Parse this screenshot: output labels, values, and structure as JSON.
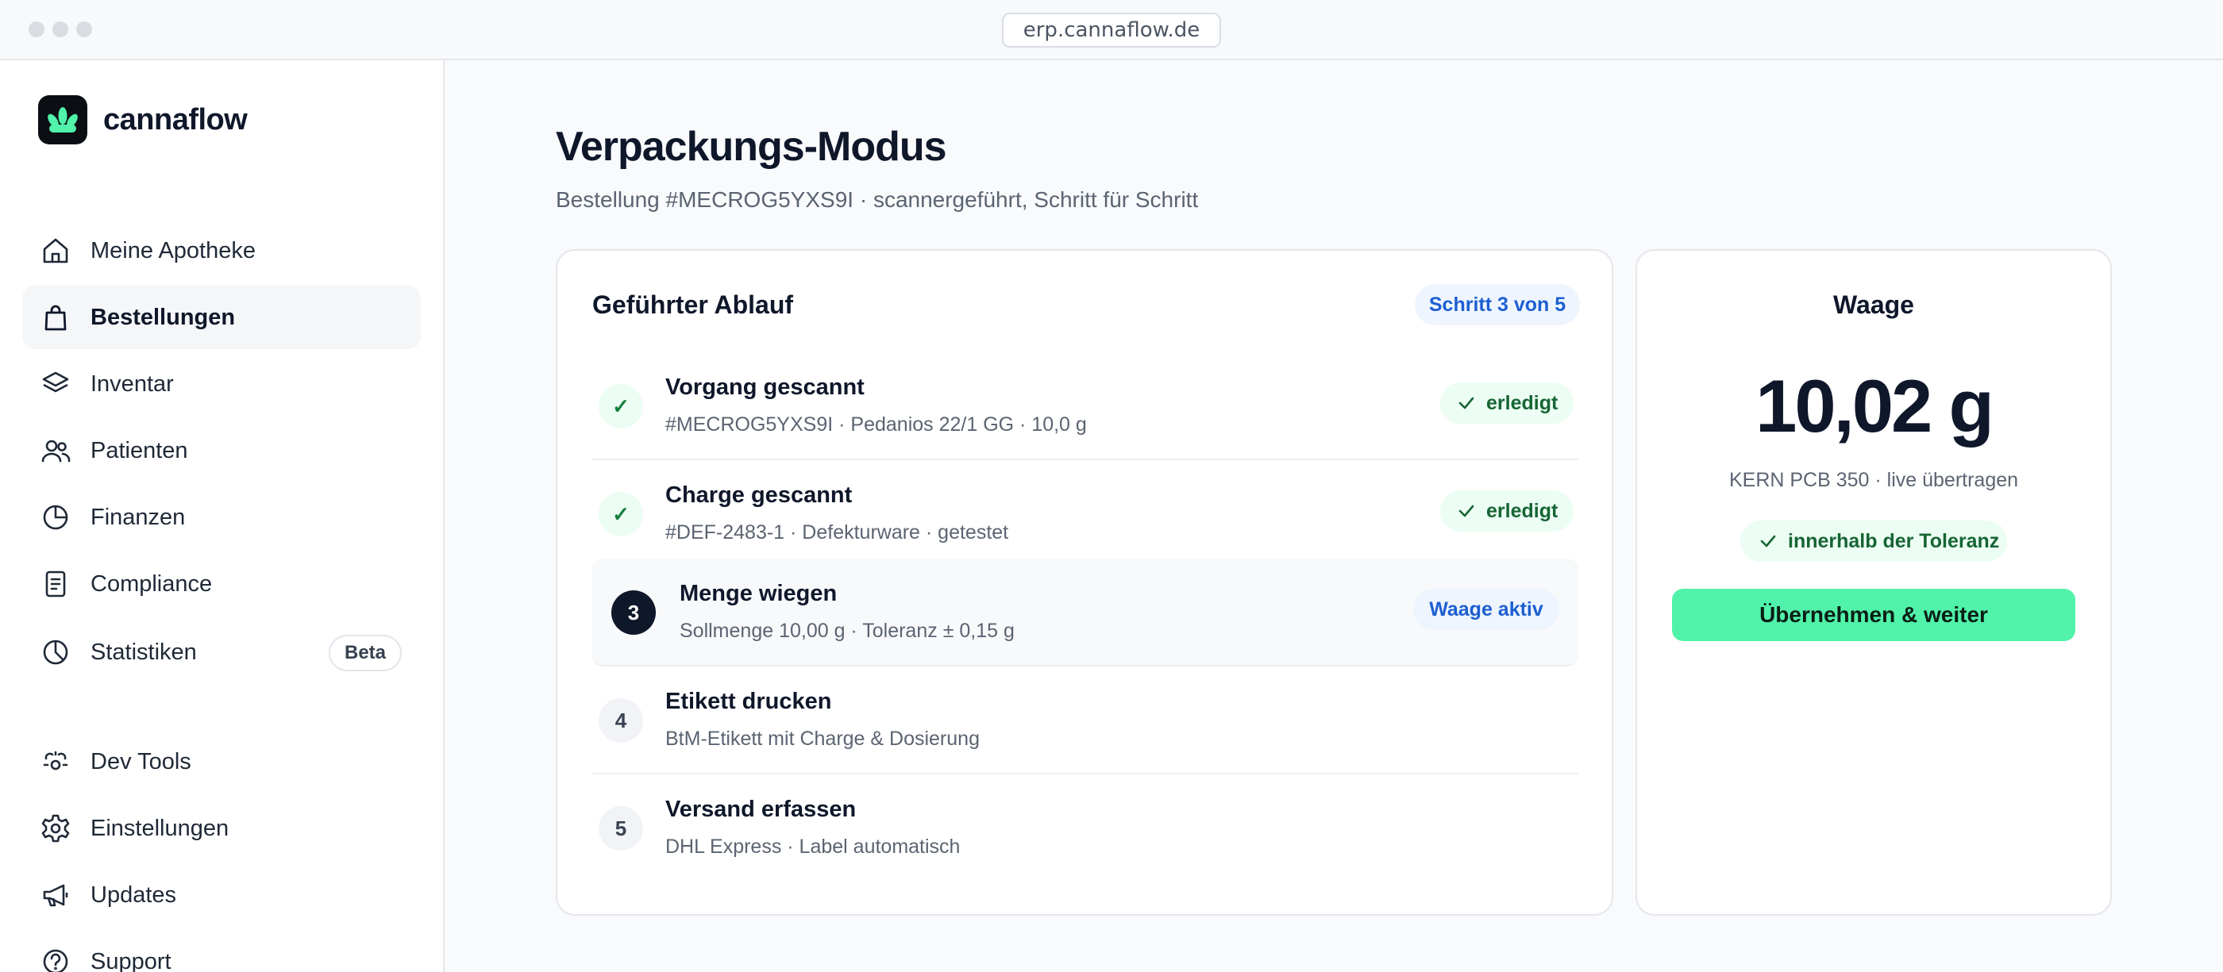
{
  "browser": {
    "url": "erp.cannaflow.de"
  },
  "brand": {
    "name": "cannaflow"
  },
  "sidebar": {
    "primary": [
      {
        "label": "Meine Apotheke",
        "icon": "home-icon"
      },
      {
        "label": "Bestellungen",
        "icon": "shopping-bag-icon",
        "active": true
      },
      {
        "label": "Inventar",
        "icon": "layers-icon"
      },
      {
        "label": "Patienten",
        "icon": "users-icon"
      },
      {
        "label": "Finanzen",
        "icon": "pie-chart-icon"
      },
      {
        "label": "Compliance",
        "icon": "document-icon"
      },
      {
        "label": "Statistiken",
        "icon": "chart-icon",
        "badge": "Beta"
      }
    ],
    "secondary": [
      {
        "label": "Dev Tools",
        "icon": "dev-tools-icon"
      },
      {
        "label": "Einstellungen",
        "icon": "gear-icon"
      },
      {
        "label": "Updates",
        "icon": "megaphone-icon"
      },
      {
        "label": "Support",
        "icon": "help-circle-icon"
      }
    ]
  },
  "page": {
    "title": "Verpackungs-Modus",
    "subtitle": "Bestellung #MECROG5YXS9I · scannergeführt, Schritt für Schritt"
  },
  "flow": {
    "title": "Geführter Ablauf",
    "step_badge": "Schritt 3 von 5",
    "steps": [
      {
        "marker": "✓",
        "state": "done",
        "title": "Vorgang gescannt",
        "detail": "#MECROG5YXS9I · Pedanios 22/1 GG · 10,0 g",
        "status": "erledigt"
      },
      {
        "marker": "✓",
        "state": "done",
        "title": "Charge gescannt",
        "detail": "#DEF-2483-1 · Defekturware · getestet",
        "status": "erledigt"
      },
      {
        "marker": "3",
        "state": "current",
        "title": "Menge wiegen",
        "detail": "Sollmenge 10,00 g · Toleranz ± 0,15 g",
        "status": "Waage aktiv"
      },
      {
        "marker": "4",
        "state": "todo",
        "title": "Etikett drucken",
        "detail": "BtM-Etikett mit Charge & Dosierung",
        "status": ""
      },
      {
        "marker": "5",
        "state": "todo",
        "title": "Versand erfassen",
        "detail": "DHL Express · Label automatisch",
        "status": ""
      }
    ]
  },
  "scale": {
    "title": "Waage",
    "value": "10,02 g",
    "device": "KERN PCB 350 · live übertragen",
    "tolerance_status": "innerhalb der Toleranz",
    "accept_label": "Übernehmen & weiter"
  },
  "colors": {
    "accent": "#50f3a9",
    "success": "#166534",
    "info": "#1d5fd1",
    "text": "#0f172a"
  }
}
